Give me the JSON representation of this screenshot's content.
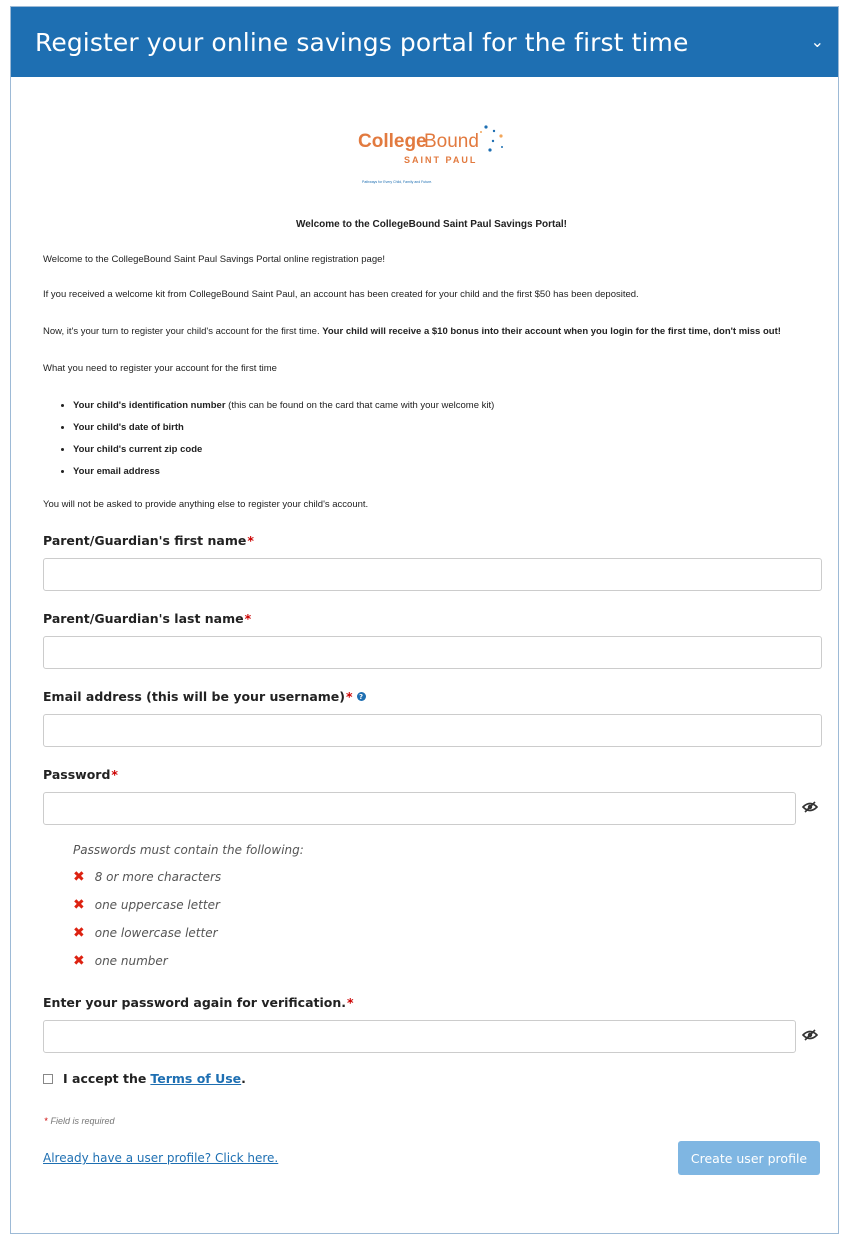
{
  "header": {
    "title": "Register your online savings portal for the first time",
    "toggle_icon": "chevron-down-icon"
  },
  "logo": {
    "part1": "College",
    "part2": "Bound",
    "sub": "SAINT PAUL",
    "tagline": "Pathways for Every Child, Family and Future.",
    "color": "#e27a3f",
    "accent": "#1e6fb2"
  },
  "intro": {
    "heading": "Welcome to the CollegeBound Saint Paul Savings Portal!",
    "p1": "Welcome to the CollegeBound Saint Paul Savings Portal online registration page!",
    "p2": "If you received a welcome kit from CollegeBound Saint Paul, an account has been created for your child and the first $50 has been deposited.",
    "p3_normal": "Now, it's your turn to register your child's account for the first time.",
    "p3_bold": "Your child will receive a $10 bonus into their account when you login for the first time, don't miss out!",
    "p4": "What you need to register your account for the first time",
    "items": [
      {
        "bold": "Your child's identification number",
        "rest": " (this can be found on the card that came with your welcome kit)"
      },
      {
        "bold": "Your child's date of birth",
        "rest": ""
      },
      {
        "bold": "Your child's current zip code",
        "rest": ""
      },
      {
        "bold": "Your email address",
        "rest": ""
      }
    ],
    "p5": "You will not be asked to provide anything else to register your child's account."
  },
  "form": {
    "first_name_label": "Parent/Guardian's first name",
    "last_name_label": "Parent/Guardian's last name",
    "email_label": "Email address (this will be your username)",
    "password_label": "Password",
    "required_mark": "*",
    "info_icon": "info-icon",
    "eye_icon": "eye-slash-icon",
    "password_rules_title": "Passwords must contain the following:",
    "password_rules": [
      "8 or more characters",
      "one uppercase letter",
      "one lowercase letter",
      "one number"
    ],
    "rule_mark": "✖",
    "confirm_label": "Enter your password again for verification.",
    "accept_text": "I accept the",
    "terms_link": "Terms of Use",
    "terms_period": ".",
    "required_note": "Field is required",
    "login_link": "Already have a user profile? Click here.",
    "create_button": "Create user profile"
  }
}
